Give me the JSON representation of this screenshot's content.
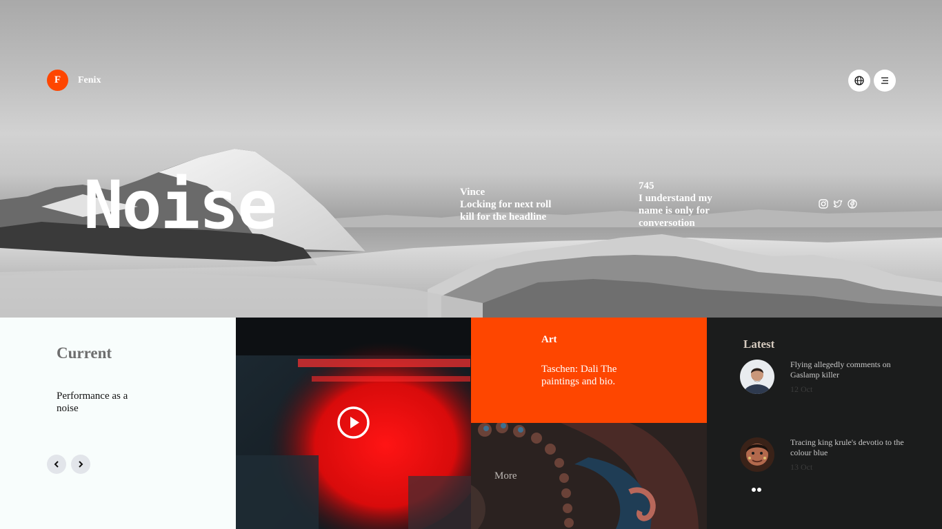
{
  "brand": {
    "logo_letter": "F",
    "name": "Fenix"
  },
  "top_actions": [
    {
      "icon": "globe-icon"
    },
    {
      "icon": "menu-icon"
    }
  ],
  "hero": {
    "title": "Noise",
    "quotes": [
      {
        "author": "Vince",
        "lines": [
          "Locking for next roll",
          "kill for the headline"
        ]
      },
      {
        "author": "745",
        "lines": [
          "I understand my",
          "name is only for",
          "conversotion"
        ]
      }
    ],
    "socials": [
      "instagram-icon",
      "twitter-icon",
      "facebook-icon"
    ]
  },
  "current": {
    "heading": "Current",
    "text": "Performance as a noise",
    "prev_icon": "chevron-left-icon",
    "next_icon": "chevron-right-icon"
  },
  "video": {
    "play_icon": "play-icon"
  },
  "art": {
    "label": "Art",
    "title": "Taschen: Dali The paintings and bio.",
    "more": "More"
  },
  "latest": {
    "heading": "Latest",
    "items": [
      {
        "headline": "Flying allegedly comments on Gaslamp killer",
        "date": "12 Oct"
      },
      {
        "headline": "Tracing king krule's devotio to the colour blue",
        "date": "13 Oct"
      }
    ]
  },
  "colors": {
    "accent": "#fe4600",
    "dark": "#1b1c1c",
    "light": "#f8fdfc"
  }
}
